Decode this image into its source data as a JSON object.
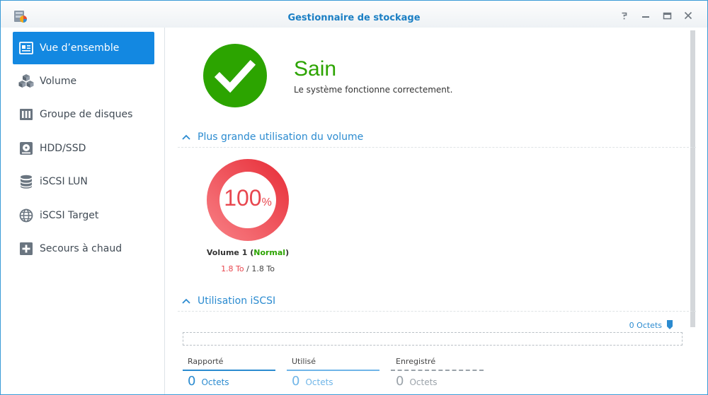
{
  "window": {
    "title": "Gestionnaire de stockage"
  },
  "colors": {
    "accent": "#1388e1",
    "healthy": "#2ca400",
    "used": "#e8474f",
    "link": "#2b8bd0"
  },
  "sidebar": {
    "items": [
      {
        "label": "Vue d’ensemble",
        "icon": "overview-icon",
        "active": true
      },
      {
        "label": "Volume",
        "icon": "volume-icon",
        "active": false
      },
      {
        "label": "Groupe de disques",
        "icon": "disk-group-icon",
        "active": false
      },
      {
        "label": "HDD/SSD",
        "icon": "hdd-icon",
        "active": false
      },
      {
        "label": "iSCSI LUN",
        "icon": "iscsi-lun-icon",
        "active": false
      },
      {
        "label": "iSCSI Target",
        "icon": "iscsi-target-icon",
        "active": false
      },
      {
        "label": "Secours à chaud",
        "icon": "hot-spare-icon",
        "active": false
      }
    ]
  },
  "overview": {
    "health": {
      "status": "Sain",
      "message": "Le système fonctionne correctement.",
      "icon": "check-icon"
    },
    "volume_section": {
      "title": "Plus grande utilisation du volume",
      "usage_percent": 100,
      "percent_sign": "%",
      "volume_name": "Volume 1",
      "volume_status": "Normal",
      "used": "1.8 To",
      "separator": "/",
      "total": "1.8 To"
    },
    "iscsi_section": {
      "title": "Utilisation iSCSI",
      "total": "0 Octets",
      "stats": [
        {
          "label": "Rapporté",
          "value": "0",
          "unit": "Octets"
        },
        {
          "label": "Utilisé",
          "value": "0",
          "unit": "Octets"
        },
        {
          "label": "Enregistré",
          "value": "0",
          "unit": "Octets"
        }
      ]
    }
  }
}
